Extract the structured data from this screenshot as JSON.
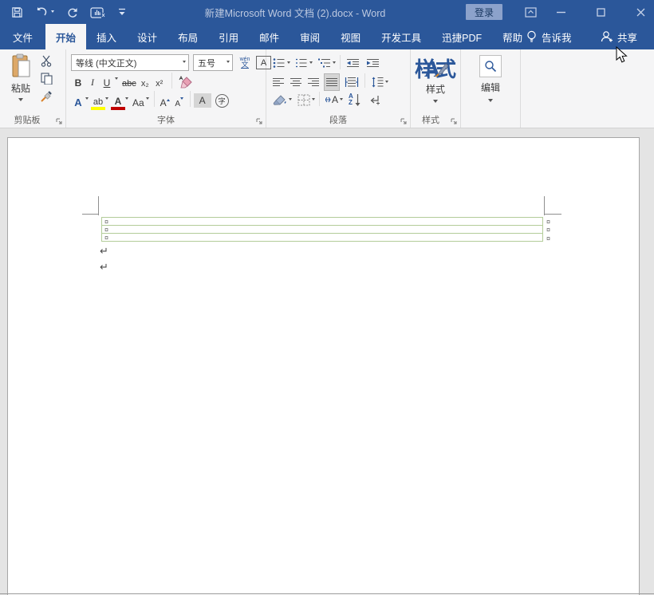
{
  "titlebar": {
    "title": "新建Microsoft Word 文档 (2).docx  -  Word",
    "signin": "登录"
  },
  "tabs": {
    "file": "文件",
    "items": [
      "开始",
      "插入",
      "设计",
      "布局",
      "引用",
      "邮件",
      "审阅",
      "视图",
      "开发工具",
      "迅捷PDF",
      "帮助"
    ],
    "tellme": "告诉我",
    "share": "共享"
  },
  "ribbon": {
    "clipboard": {
      "label": "剪贴板",
      "paste": "粘贴"
    },
    "font": {
      "label": "字体",
      "name": "等线 (中文正文)",
      "size": "五号",
      "bold": "B",
      "italic": "I",
      "underline": "U",
      "strikethrough": "abc",
      "subscript": "x₂",
      "superscript": "x²",
      "text_effects": "A",
      "highlight": "ab",
      "font_color": "A",
      "change_case": "Aa",
      "grow": "A",
      "shrink": "A",
      "char_shading": "A",
      "enclose": "字",
      "phonetic_top": "wén",
      "phonetic_bottom": "文",
      "char_border": "A"
    },
    "paragraph": {
      "label": "段落",
      "sort_a": "A",
      "sort_z": "Z",
      "asian": "A"
    },
    "styles": {
      "label": "样式",
      "button": "样式"
    },
    "editing": {
      "button": "编辑"
    }
  },
  "document": {
    "cell_marker": "¤",
    "paragraph_mark": "↵",
    "table_rows": 3
  },
  "colors": {
    "accent": "#2b579a",
    "table_border": "#b3cc99",
    "highlight_yellow": "#ffff00",
    "font_color_red": "#c00000"
  }
}
